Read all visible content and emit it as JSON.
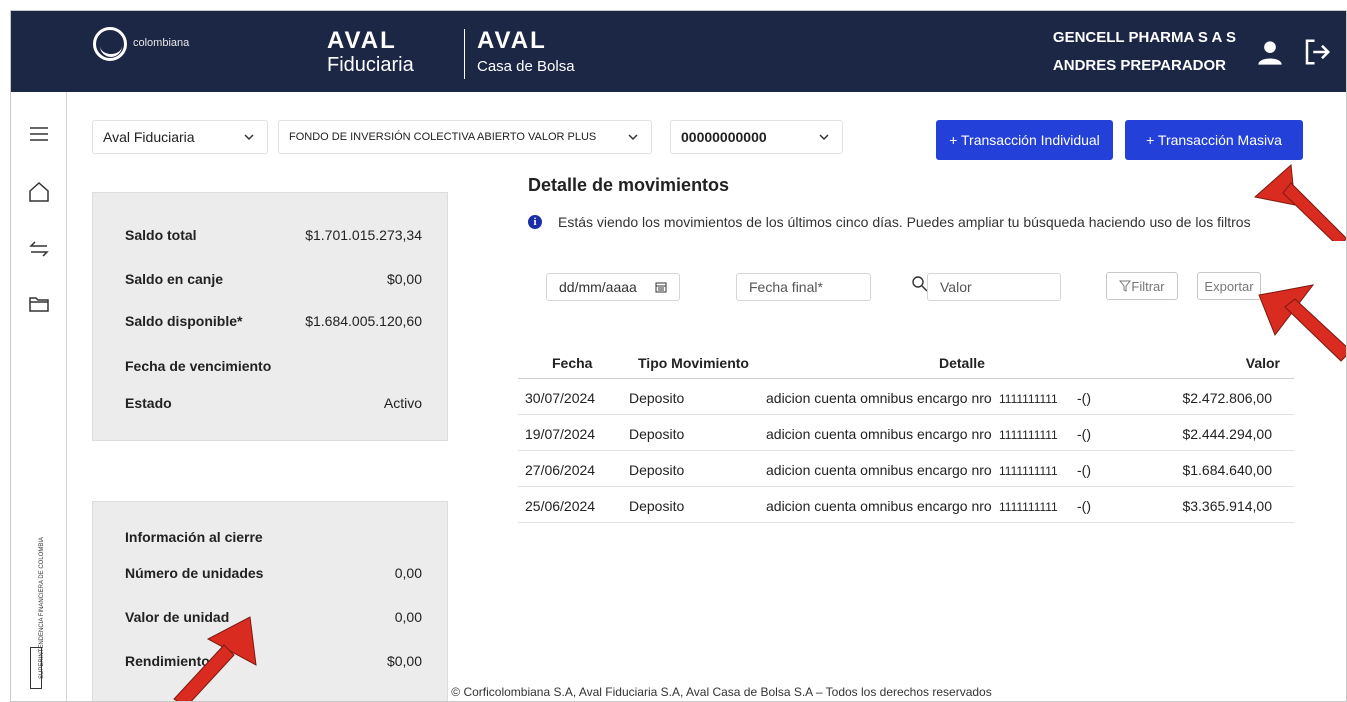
{
  "header": {
    "corfi_logo": "corfi",
    "corfi_sub": "colombiana",
    "aval_fiduciaria_mark": "AVAL",
    "aval_fiduciaria_name": "Fiduciaria",
    "aval_casa_mark": "AVAL",
    "aval_casa_name": "Casa de Bolsa",
    "company": "GENCELL PHARMA S A S",
    "user": "ANDRES PREPARADOR"
  },
  "sidebar": {
    "items": [
      "menu-icon",
      "home-icon",
      "transfer-icon",
      "folder-icon"
    ],
    "vigilado": "SUPERINTENDENCIA FINANCIERA DE COLOMBIA",
    "vigilado_box": "VIGILADO"
  },
  "filters": {
    "entity": "Aval Fiduciaria",
    "fund": "FONDO DE INVERSIÓN COLECTIVA ABIERTO VALOR PLUS",
    "account": "00000000000"
  },
  "actions": {
    "individual": "+ Transacción Individual",
    "masiva": "+ Transacción Masiva"
  },
  "summary": {
    "rows": [
      {
        "label": "Saldo total",
        "value": "$1.701.015.273,34"
      },
      {
        "label": "Saldo en canje",
        "value": "$0,00"
      },
      {
        "label": "Saldo disponible*",
        "value": "$1.684.005.120,60"
      },
      {
        "label": "Fecha de vencimiento",
        "value": ""
      },
      {
        "label": "Estado",
        "value": "Activo"
      }
    ]
  },
  "closing": {
    "title": "Información al cierre",
    "rows": [
      {
        "label": "Número de unidades",
        "value": "0,00"
      },
      {
        "label": "Valor de unidad",
        "value": "0,00"
      },
      {
        "label": "Rendimientos",
        "value": "$0,00"
      }
    ]
  },
  "movements": {
    "title": "Detalle de movimientos",
    "info": "Estás viendo los movimientos de los últimos cinco días. Puedes ampliar tu búsqueda haciendo uso de los filtros",
    "date_start_placeholder": "dd/mm/aaaa",
    "date_end_placeholder": "Fecha final*",
    "value_placeholder": "Valor",
    "filter_label": "Filtrar",
    "export_label": "Exportar",
    "columns": [
      "Fecha",
      "Tipo Movimiento",
      "Detalle",
      "Valor"
    ],
    "rows": [
      {
        "fecha": "30/07/2024",
        "tipo": "Deposito",
        "detalle": "adicion cuenta omnibus encargo nro",
        "numero": "1111111111",
        "sufijo": "-()",
        "valor": "$2.472.806,00"
      },
      {
        "fecha": "19/07/2024",
        "tipo": "Deposito",
        "detalle": "adicion cuenta omnibus encargo nro",
        "numero": "1111111111",
        "sufijo": "-()",
        "valor": "$2.444.294,00"
      },
      {
        "fecha": "27/06/2024",
        "tipo": "Deposito",
        "detalle": "adicion cuenta omnibus encargo nro",
        "numero": "1111111111",
        "sufijo": "-()",
        "valor": "$1.684.640,00"
      },
      {
        "fecha": "25/06/2024",
        "tipo": "Deposito",
        "detalle": "adicion cuenta omnibus encargo nro",
        "numero": "1111111111",
        "sufijo": "-()",
        "valor": "$3.365.914,00"
      }
    ]
  },
  "footer": "© Corficolombiana S.A, Aval Fiduciaria S.A, Aval Casa de Bolsa S.A – Todos los derechos reservados",
  "colors": {
    "header_bg": "#1c2645",
    "primary_button": "#2340d8",
    "annotation_arrow": "#d92b1f",
    "panel_bg": "#ececec"
  }
}
